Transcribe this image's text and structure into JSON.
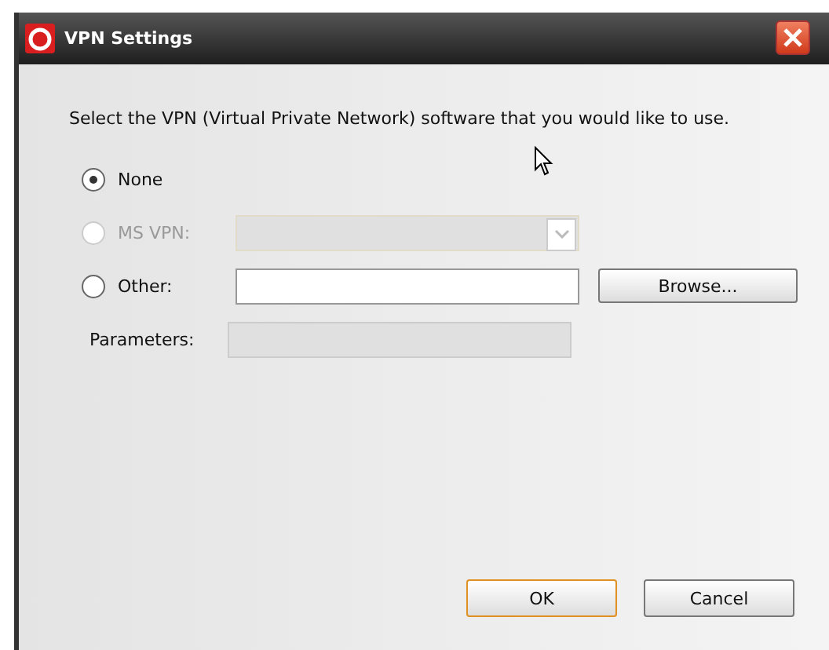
{
  "window": {
    "title": "VPN Settings"
  },
  "instruction": "Select the VPN (Virtual Private Network) software that you would like to use.",
  "options": [
    {
      "label": "None",
      "selected": true,
      "disabled": false,
      "kind": "plain"
    },
    {
      "label": "MS VPN:",
      "selected": false,
      "disabled": true,
      "kind": "dropdown"
    },
    {
      "label": "Other:",
      "selected": false,
      "disabled": false,
      "kind": "file",
      "browse": "Browse..."
    }
  ],
  "parameters": {
    "label": "Parameters:",
    "disabled": true
  },
  "buttons": [
    {
      "label": "OK",
      "default": true
    },
    {
      "label": "Cancel",
      "default": false
    }
  ]
}
